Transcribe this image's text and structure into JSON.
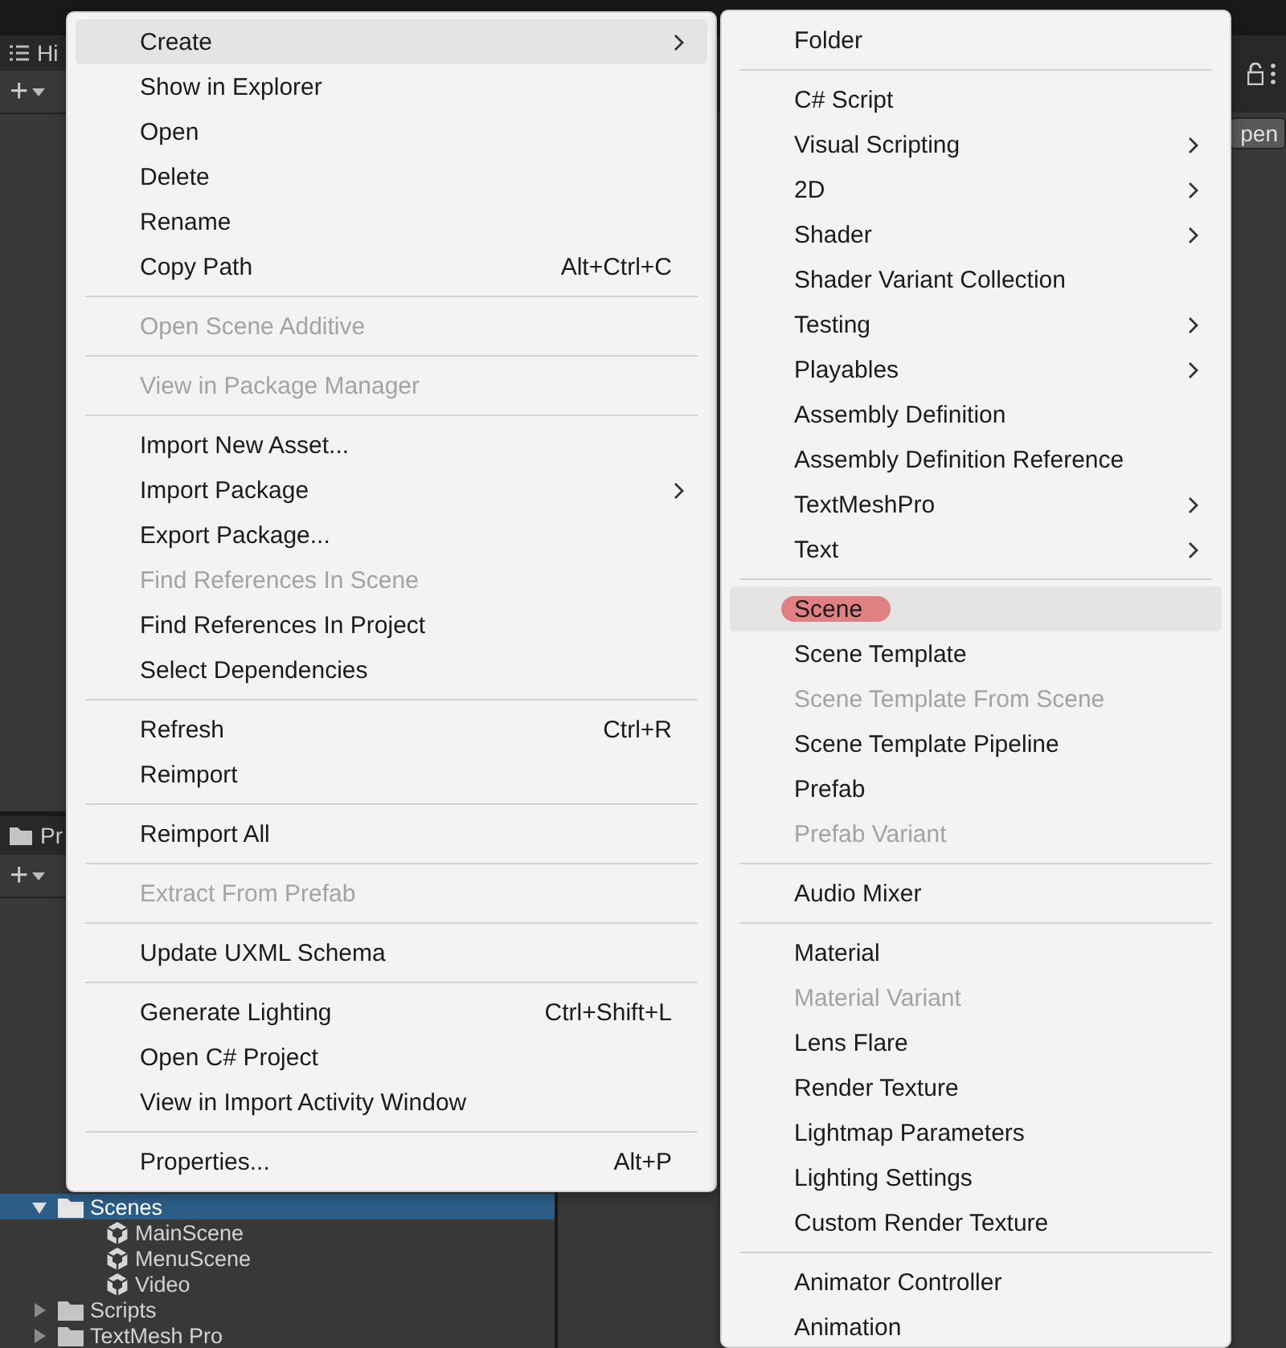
{
  "hierarchy": {
    "tab": "Hi",
    "add_button": "+"
  },
  "inspector": {
    "button": "pen"
  },
  "project": {
    "tab": "Pr",
    "add_button": "+",
    "tree": [
      {
        "label": "Scenes",
        "kind": "folder",
        "expanded": true,
        "selected": true,
        "children": [
          {
            "label": "MainScene",
            "kind": "scene",
            "selected": false
          },
          {
            "label": "MenuScene",
            "kind": "scene",
            "selected": false
          },
          {
            "label": "Video",
            "kind": "scene",
            "selected": false
          }
        ]
      },
      {
        "label": "Scripts",
        "kind": "folder",
        "expanded": false,
        "selected": false
      },
      {
        "label": "TextMesh Pro",
        "kind": "folder",
        "expanded": false,
        "selected": false
      }
    ]
  },
  "menu": {
    "items": [
      {
        "kind": "item",
        "label": "Create",
        "submenu": true,
        "disabled": false,
        "selected": true
      },
      {
        "kind": "item",
        "label": "Show in Explorer",
        "submenu": false,
        "disabled": false,
        "selected": false
      },
      {
        "kind": "item",
        "label": "Open",
        "submenu": false,
        "disabled": false,
        "selected": false
      },
      {
        "kind": "item",
        "label": "Delete",
        "submenu": false,
        "disabled": false,
        "selected": false
      },
      {
        "kind": "item",
        "label": "Rename",
        "submenu": false,
        "disabled": false,
        "selected": false
      },
      {
        "kind": "item",
        "label": "Copy Path",
        "shortcut": "Alt+Ctrl+C",
        "submenu": false,
        "disabled": false,
        "selected": false
      },
      {
        "kind": "separator"
      },
      {
        "kind": "item",
        "label": "Open Scene Additive",
        "submenu": false,
        "disabled": true,
        "selected": false
      },
      {
        "kind": "separator"
      },
      {
        "kind": "item",
        "label": "View in Package Manager",
        "submenu": false,
        "disabled": true,
        "selected": false
      },
      {
        "kind": "separator"
      },
      {
        "kind": "item",
        "label": "Import New Asset...",
        "submenu": false,
        "disabled": false,
        "selected": false
      },
      {
        "kind": "item",
        "label": "Import Package",
        "submenu": true,
        "disabled": false,
        "selected": false
      },
      {
        "kind": "item",
        "label": "Export Package...",
        "submenu": false,
        "disabled": false,
        "selected": false
      },
      {
        "kind": "item",
        "label": "Find References In Scene",
        "submenu": false,
        "disabled": true,
        "selected": false
      },
      {
        "kind": "item",
        "label": "Find References In Project",
        "submenu": false,
        "disabled": false,
        "selected": false
      },
      {
        "kind": "item",
        "label": "Select Dependencies",
        "submenu": false,
        "disabled": false,
        "selected": false
      },
      {
        "kind": "separator"
      },
      {
        "kind": "item",
        "label": "Refresh",
        "shortcut": "Ctrl+R",
        "submenu": false,
        "disabled": false,
        "selected": false
      },
      {
        "kind": "item",
        "label": "Reimport",
        "submenu": false,
        "disabled": false,
        "selected": false
      },
      {
        "kind": "separator"
      },
      {
        "kind": "item",
        "label": "Reimport All",
        "submenu": false,
        "disabled": false,
        "selected": false
      },
      {
        "kind": "separator"
      },
      {
        "kind": "item",
        "label": "Extract From Prefab",
        "submenu": false,
        "disabled": true,
        "selected": false
      },
      {
        "kind": "separator"
      },
      {
        "kind": "item",
        "label": "Update UXML Schema",
        "submenu": false,
        "disabled": false,
        "selected": false
      },
      {
        "kind": "separator"
      },
      {
        "kind": "item",
        "label": "Generate Lighting",
        "shortcut": "Ctrl+Shift+L",
        "submenu": false,
        "disabled": false,
        "selected": false
      },
      {
        "kind": "item",
        "label": "Open C# Project",
        "submenu": false,
        "disabled": false,
        "selected": false
      },
      {
        "kind": "item",
        "label": "View in Import Activity Window",
        "submenu": false,
        "disabled": false,
        "selected": false
      },
      {
        "kind": "separator"
      },
      {
        "kind": "item",
        "label": "Properties...",
        "shortcut": "Alt+P",
        "submenu": false,
        "disabled": false,
        "selected": false
      }
    ]
  },
  "submenu": {
    "items": [
      {
        "kind": "item",
        "label": "Folder",
        "submenu": false,
        "disabled": false,
        "selected": false,
        "marked": false
      },
      {
        "kind": "separator"
      },
      {
        "kind": "item",
        "label": "C# Script",
        "submenu": false,
        "disabled": false,
        "selected": false,
        "marked": false
      },
      {
        "kind": "item",
        "label": "Visual Scripting",
        "submenu": true,
        "disabled": false,
        "selected": false,
        "marked": false
      },
      {
        "kind": "item",
        "label": "2D",
        "submenu": true,
        "disabled": false,
        "selected": false,
        "marked": false
      },
      {
        "kind": "item",
        "label": "Shader",
        "submenu": true,
        "disabled": false,
        "selected": false,
        "marked": false
      },
      {
        "kind": "item",
        "label": "Shader Variant Collection",
        "submenu": false,
        "disabled": false,
        "selected": false,
        "marked": false
      },
      {
        "kind": "item",
        "label": "Testing",
        "submenu": true,
        "disabled": false,
        "selected": false,
        "marked": false
      },
      {
        "kind": "item",
        "label": "Playables",
        "submenu": true,
        "disabled": false,
        "selected": false,
        "marked": false
      },
      {
        "kind": "item",
        "label": "Assembly Definition",
        "submenu": false,
        "disabled": false,
        "selected": false,
        "marked": false
      },
      {
        "kind": "item",
        "label": "Assembly Definition Reference",
        "submenu": false,
        "disabled": false,
        "selected": false,
        "marked": false
      },
      {
        "kind": "item",
        "label": "TextMeshPro",
        "submenu": true,
        "disabled": false,
        "selected": false,
        "marked": false
      },
      {
        "kind": "item",
        "label": "Text",
        "submenu": true,
        "disabled": false,
        "selected": false,
        "marked": false
      },
      {
        "kind": "separator"
      },
      {
        "kind": "item",
        "label": "Scene",
        "submenu": false,
        "disabled": false,
        "selected": true,
        "marked": true
      },
      {
        "kind": "item",
        "label": "Scene Template",
        "submenu": false,
        "disabled": false,
        "selected": false,
        "marked": false
      },
      {
        "kind": "item",
        "label": "Scene Template From Scene",
        "submenu": false,
        "disabled": true,
        "selected": false,
        "marked": false
      },
      {
        "kind": "item",
        "label": "Scene Template Pipeline",
        "submenu": false,
        "disabled": false,
        "selected": false,
        "marked": false
      },
      {
        "kind": "item",
        "label": "Prefab",
        "submenu": false,
        "disabled": false,
        "selected": false,
        "marked": false
      },
      {
        "kind": "item",
        "label": "Prefab Variant",
        "submenu": false,
        "disabled": true,
        "selected": false,
        "marked": false
      },
      {
        "kind": "separator"
      },
      {
        "kind": "item",
        "label": "Audio Mixer",
        "submenu": false,
        "disabled": false,
        "selected": false,
        "marked": false
      },
      {
        "kind": "separator"
      },
      {
        "kind": "item",
        "label": "Material",
        "submenu": false,
        "disabled": false,
        "selected": false,
        "marked": false
      },
      {
        "kind": "item",
        "label": "Material Variant",
        "submenu": false,
        "disabled": true,
        "selected": false,
        "marked": false
      },
      {
        "kind": "item",
        "label": "Lens Flare",
        "submenu": false,
        "disabled": false,
        "selected": false,
        "marked": false
      },
      {
        "kind": "item",
        "label": "Render Texture",
        "submenu": false,
        "disabled": false,
        "selected": false,
        "marked": false
      },
      {
        "kind": "item",
        "label": "Lightmap Parameters",
        "submenu": false,
        "disabled": false,
        "selected": false,
        "marked": false
      },
      {
        "kind": "item",
        "label": "Lighting Settings",
        "submenu": false,
        "disabled": false,
        "selected": false,
        "marked": false
      },
      {
        "kind": "item",
        "label": "Custom Render Texture",
        "submenu": false,
        "disabled": false,
        "selected": false,
        "marked": false
      },
      {
        "kind": "separator"
      },
      {
        "kind": "item",
        "label": "Animator Controller",
        "submenu": false,
        "disabled": false,
        "selected": false,
        "marked": false
      },
      {
        "kind": "item",
        "label": "Animation",
        "submenu": false,
        "disabled": false,
        "selected": false,
        "marked": false
      }
    ]
  }
}
